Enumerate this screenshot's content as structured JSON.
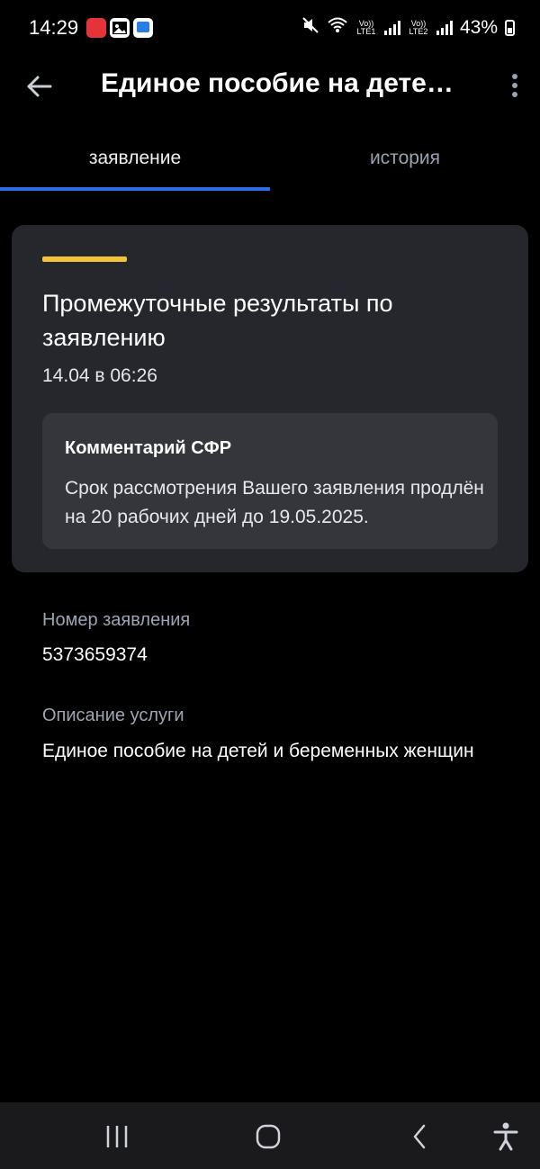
{
  "status_bar": {
    "time": "14:29",
    "signal_1": "Vo)) LTE1",
    "signal_2": "Vo)) LTE2",
    "battery": "43%"
  },
  "app_bar": {
    "title": "Единое пособие на детей…"
  },
  "tabs": [
    {
      "label": "заявление",
      "active": true
    },
    {
      "label": "история",
      "active": false
    }
  ],
  "card": {
    "title": "Промежуточные результаты по заявлению",
    "date": "14.04 в 06:26",
    "comment": {
      "heading": "Комментарий СФР",
      "text": "Срок рассмотрения Вашего заявления продлён на 20 рабочих дней до 19.05.2025."
    }
  },
  "details": {
    "number_label": "Номер заявления",
    "number_value": "5373659374",
    "description_label": "Описание услуги",
    "description_value": "Единое пособие на детей и беременных женщин"
  },
  "colors": {
    "accent": "#2f6fe6",
    "highlight": "#f2c23b",
    "card": "#26272c",
    "comment_box": "#35363c"
  }
}
